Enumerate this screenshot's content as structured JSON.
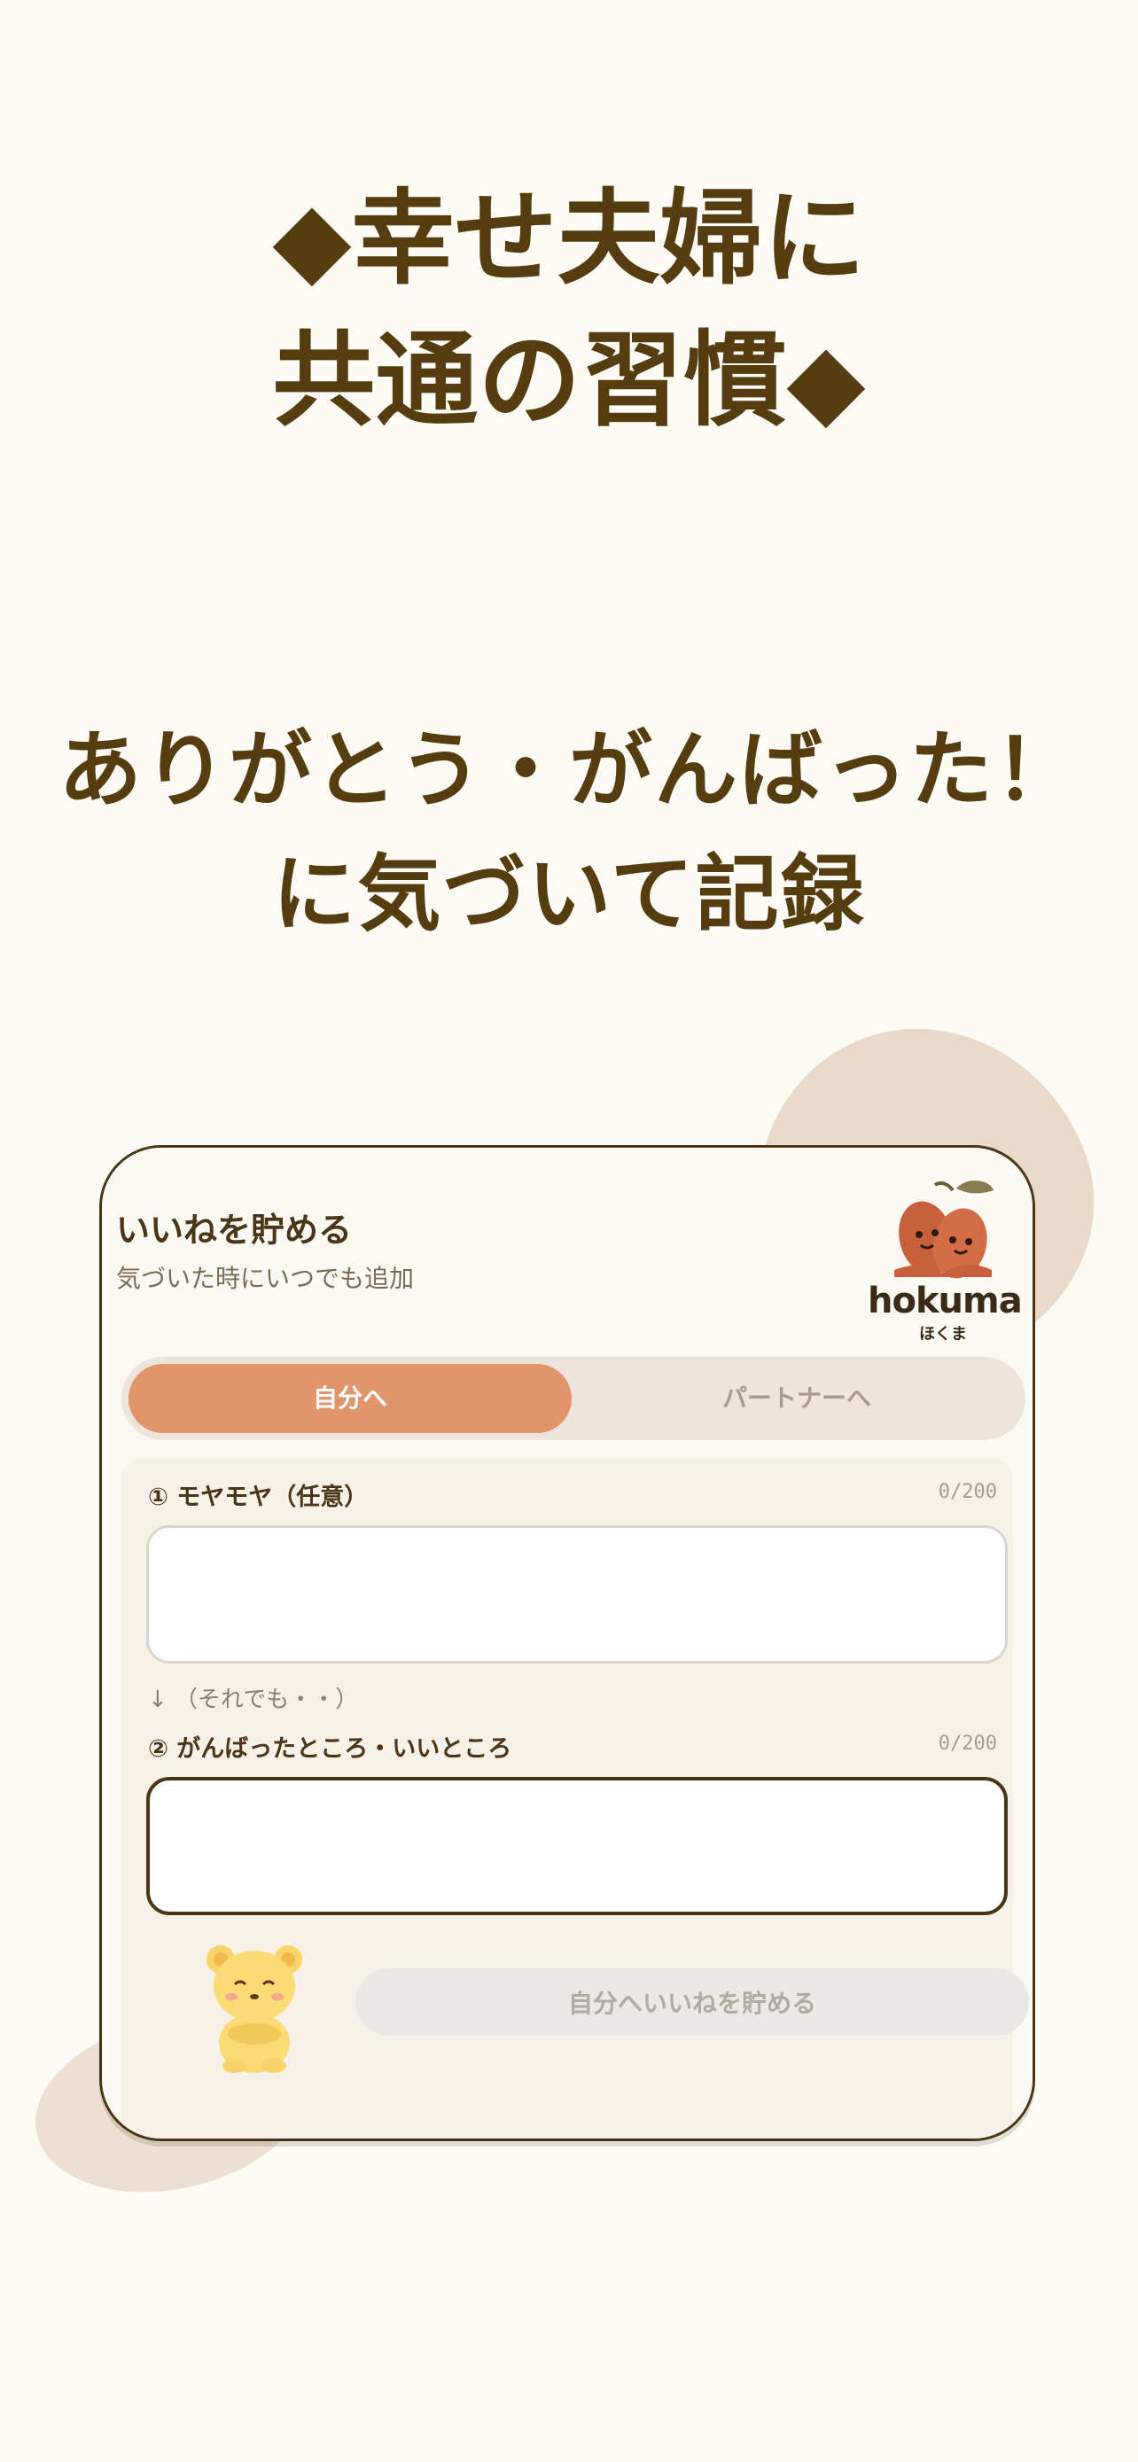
{
  "headline1": {
    "line1": "◆幸せ夫婦に",
    "line2": "共通の習慣◆"
  },
  "headline2": {
    "line1": "ありがとう・がんばった！",
    "line2": "に気づいて記録"
  },
  "card": {
    "title": "いいねを貯める",
    "subtitle": "気づいた時にいつでも追加",
    "logo": {
      "name": "hokuma",
      "kana": "ほくま",
      "icon": "sweet-potato-mascot-icon"
    },
    "tabs": [
      {
        "label": "自分へ",
        "selected": true
      },
      {
        "label": "パートナーへ",
        "selected": false
      }
    ],
    "field1": {
      "label": "① モヤモヤ（任意）",
      "count": "0/200",
      "value": ""
    },
    "hint": "↓ （それでも・・）",
    "field2": {
      "label": "② がんばったところ・いいところ",
      "count": "0/200",
      "value": ""
    },
    "mascot_icon": "bear-icon",
    "submit_label": "自分へいいねを貯める"
  },
  "colors": {
    "background": "#fdfbf6",
    "headline": "#563d0f",
    "accent": "#e0956a",
    "card_border": "#4a3516",
    "blob": "#ead9c8"
  }
}
